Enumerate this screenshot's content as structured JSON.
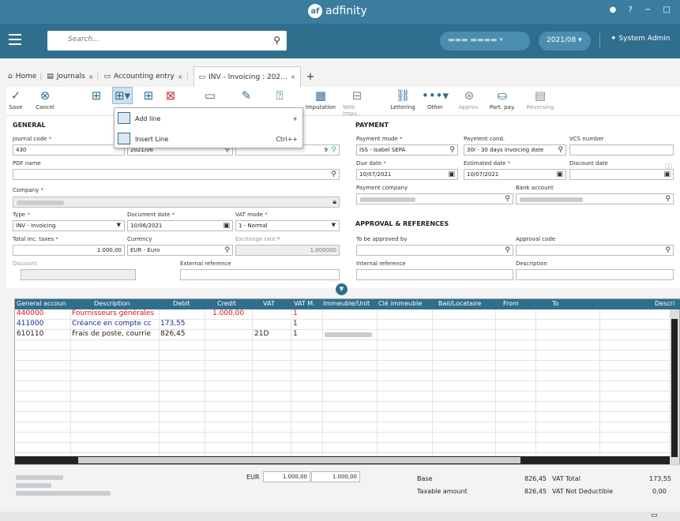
{
  "app": {
    "title": "adfinity",
    "logo": "af",
    "window_controls": "? − □"
  },
  "header": {
    "search_placeholder": "Search...",
    "period": "2021/08 ▾",
    "system_label": "System Admin"
  },
  "tabs": [
    {
      "label": "Home"
    },
    {
      "label": "Journals"
    },
    {
      "label": "Accounting entry"
    },
    {
      "label": "INV - Invoicing : 202..."
    }
  ],
  "toolbar": {
    "save": "Save",
    "cancel": "Cancel",
    "imputation": "Imputation",
    "web_impu": "Web impu..",
    "lettering": "Lettering",
    "other": "Other",
    "approv": "Approv.",
    "part_pay": "Part. pay.",
    "reversing": "Reversing"
  },
  "menu": {
    "add_line": "Add line",
    "add_plus": "+",
    "insert_line": "Insert Line",
    "insert_shortcut": "Ctrl++"
  },
  "general": {
    "title": "GENERAL",
    "journal_code_label": "Journal code",
    "journal_code": "430",
    "doc_period": "2021/06",
    "doc_number": "9",
    "pdf_name_label": "PDF name",
    "company_label": "Company",
    "type_label": "Type",
    "type": "INV - Invoicing",
    "doc_date_label": "Document date",
    "doc_date": "10/06/2021",
    "vat_mode_label": "VAT mode",
    "vat_mode": "1 - Normal",
    "total_label": "Total inc. taxes",
    "total": "1.000,00",
    "currency_label": "Currency",
    "currency": "EUR - Euro",
    "rate_label": "Exchange rate",
    "rate": "1,000000",
    "discount_label": "Discount",
    "ext_ref_label": "External reference"
  },
  "payment": {
    "title": "PAYMENT",
    "mode_label": "Payment mode",
    "mode": "ISS - Isabel SEPA",
    "cond_label": "Payment cond.",
    "cond": "30I - 30 days invoicing date",
    "vcs_label": "VCS number",
    "due_label": "Due date",
    "due": "10/07/2021",
    "est_label": "Estimated date",
    "est": "10/07/2021",
    "disc_date_label": "Discount date",
    "pay_company_label": "Payment company",
    "bank_label": "Bank account"
  },
  "approval": {
    "title": "APPROVAL & REFERENCES",
    "approved_label": "To be approved by",
    "code_label": "Approval code",
    "internal_label": "Internal reference",
    "desc_label": "Description"
  },
  "grid": {
    "columns": [
      "General accoun",
      "Description",
      "Debit",
      "Credit",
      "VAT",
      "VAT M.",
      "Immeuble/Unit",
      "Clé immeuble",
      "Bail/Locataire",
      "From",
      "To",
      "Descri"
    ],
    "rows": [
      {
        "account": "440000",
        "desc": "Fournisseurs générales",
        "debit": "",
        "credit": "1.000,00",
        "vat": "",
        "vatm": "1",
        "color": "#d11"
      },
      {
        "account": "411000",
        "desc": "Créance en compte cc",
        "debit": "173,55",
        "credit": "",
        "vat": "",
        "vatm": "1",
        "color": "#1a2a8a"
      },
      {
        "account": "610110",
        "desc": "Frais de poste, courrie",
        "debit": "826,45",
        "credit": "",
        "vat": "21D",
        "vatm": "1",
        "color": "#222"
      }
    ]
  },
  "totals": {
    "currency": "EUR",
    "debit": "1.000,00",
    "credit": "1.000,00",
    "base_label": "Base",
    "base": "826,45",
    "vat_total_label": "VAT Total",
    "vat_total": "173,55",
    "taxable_label": "Taxable amount",
    "taxable": "826,45",
    "vat_nd_label": "VAT Not Deductible",
    "vat_nd": "0,00"
  }
}
